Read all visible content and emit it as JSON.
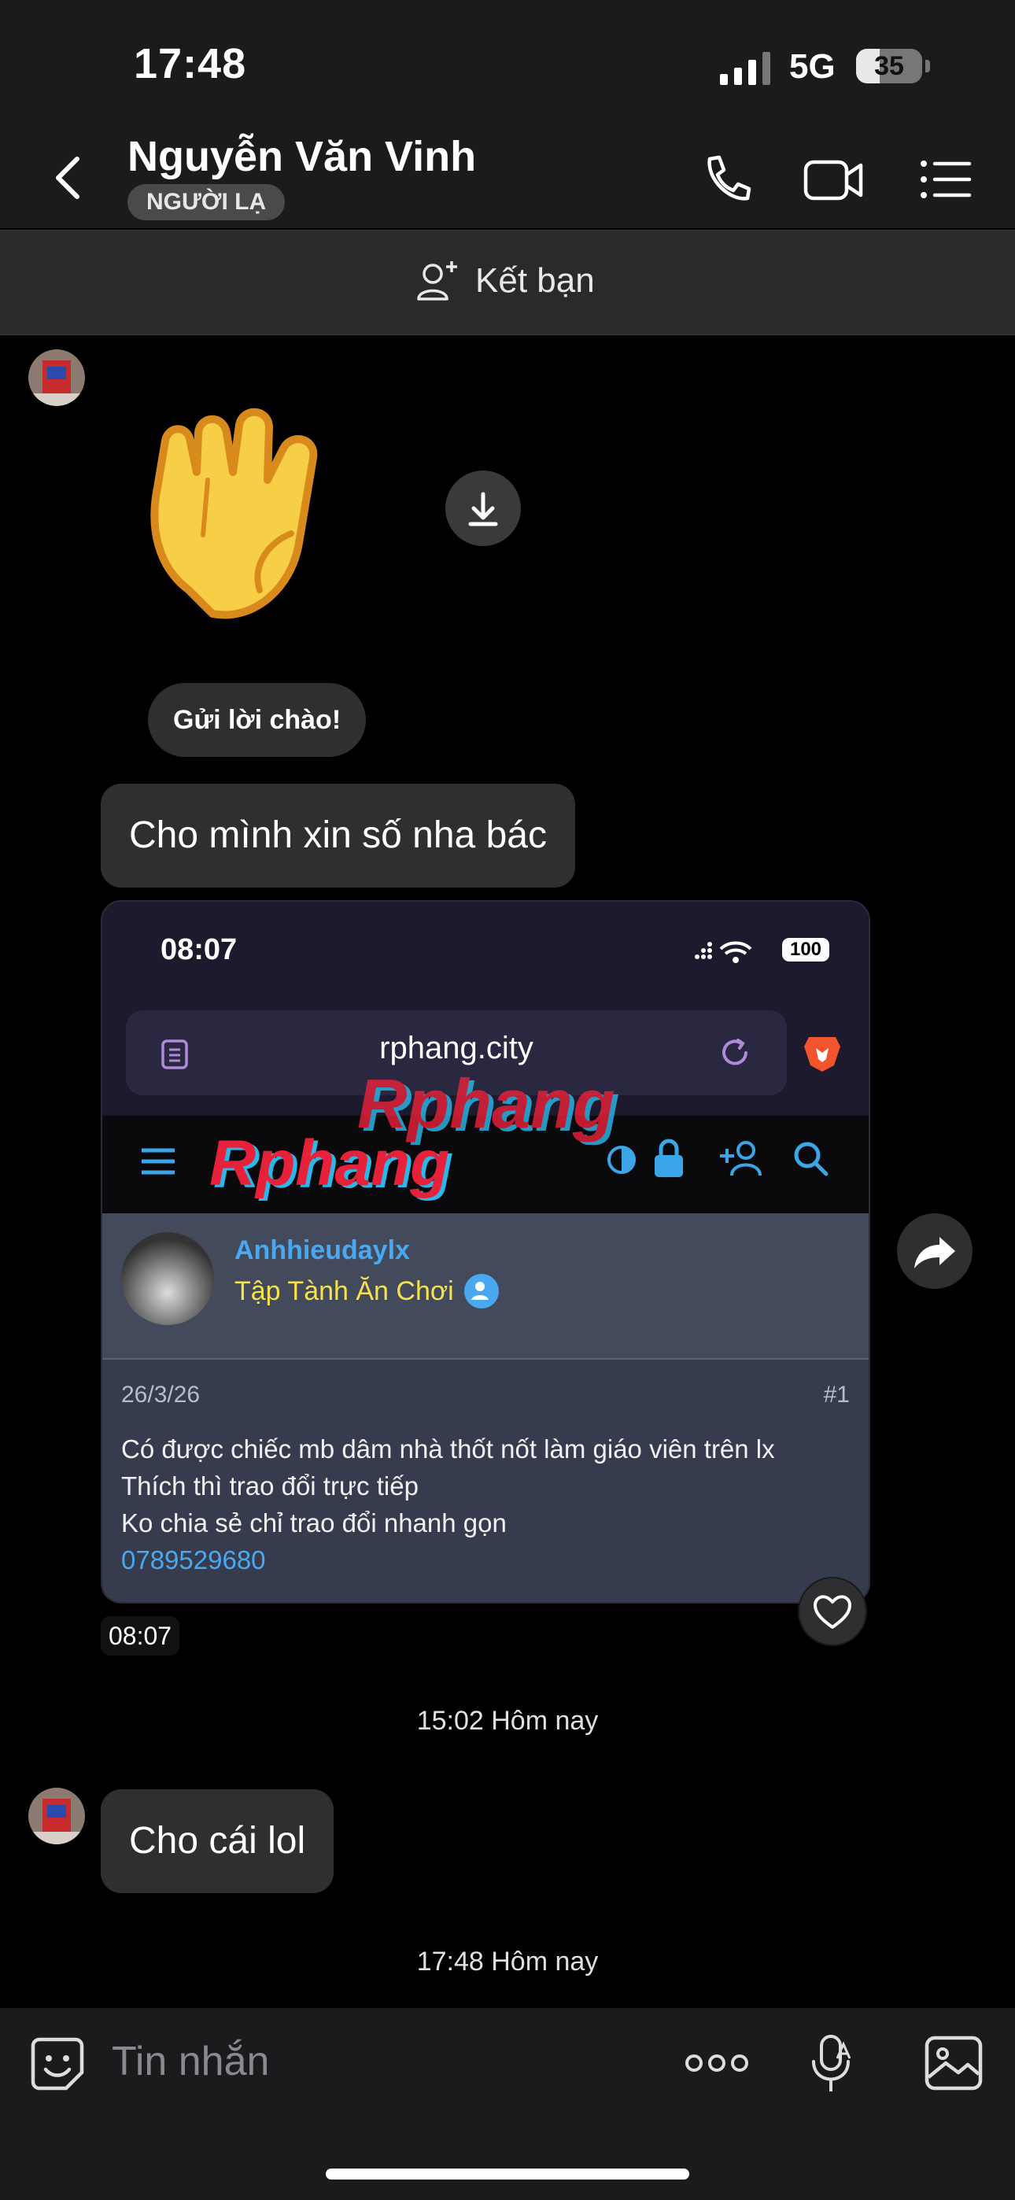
{
  "status_bar": {
    "time": "17:48",
    "network": "5G",
    "battery": "35"
  },
  "header": {
    "name": "Nguyễn Văn Vinh",
    "badge": "NGƯỜI LẠ",
    "icons": [
      "phone-icon",
      "video-icon",
      "menu-icon"
    ]
  },
  "friend_bar": {
    "label": "Kết bạn"
  },
  "messages": {
    "greeting_label": "Gửi lời chào!",
    "msg1": "Cho mình xin số nha bác",
    "image_time": "08:07",
    "divider1": "15:02 Hôm nay",
    "msg2": "Cho cái lol",
    "divider2": "17:48 Hôm nay"
  },
  "screenshot": {
    "time": "08:07",
    "battery": "100",
    "url": "rphang.city",
    "logo_text": "Rphang",
    "watermark_text": "Rphang",
    "username": "Anhhieudaylx",
    "user_title": "Tập Tành Ăn Chơi",
    "post_date": "26/3/26",
    "post_number": "#1",
    "post_lines": [
      "Có được chiếc mb dâm nhà thốt nốt làm giáo viên trên lx",
      "Thích thì trao đổi trực tiếp",
      "Ko chia sẻ chỉ trao đổi nhanh gọn"
    ],
    "phone": "0789529680"
  },
  "composer": {
    "placeholder": "Tin nhắn"
  },
  "colors": {
    "accent_blue": "#4aa8f0",
    "title_yellow": "#f6e34b",
    "logo_red": "#e8213a",
    "logo_cyan": "#2ab8e8"
  }
}
